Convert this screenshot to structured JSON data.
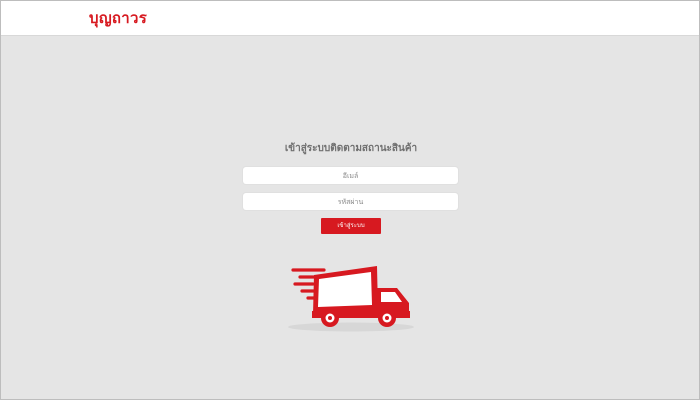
{
  "header": {
    "logo_text": "บุญถาวร"
  },
  "login": {
    "title": "เข้าสู่ระบบติดตามสถานะสินค้า",
    "email_placeholder": "อีเมล์",
    "password_placeholder": "รหัสผ่าน",
    "button_label": "เข้าสู่ระบบ"
  },
  "illustration": {
    "icon": "delivery-truck-icon"
  },
  "colors": {
    "brand_red": "#d71920",
    "background": "#e5e5e5",
    "header_background": "#ffffff",
    "title_text": "#707070"
  }
}
